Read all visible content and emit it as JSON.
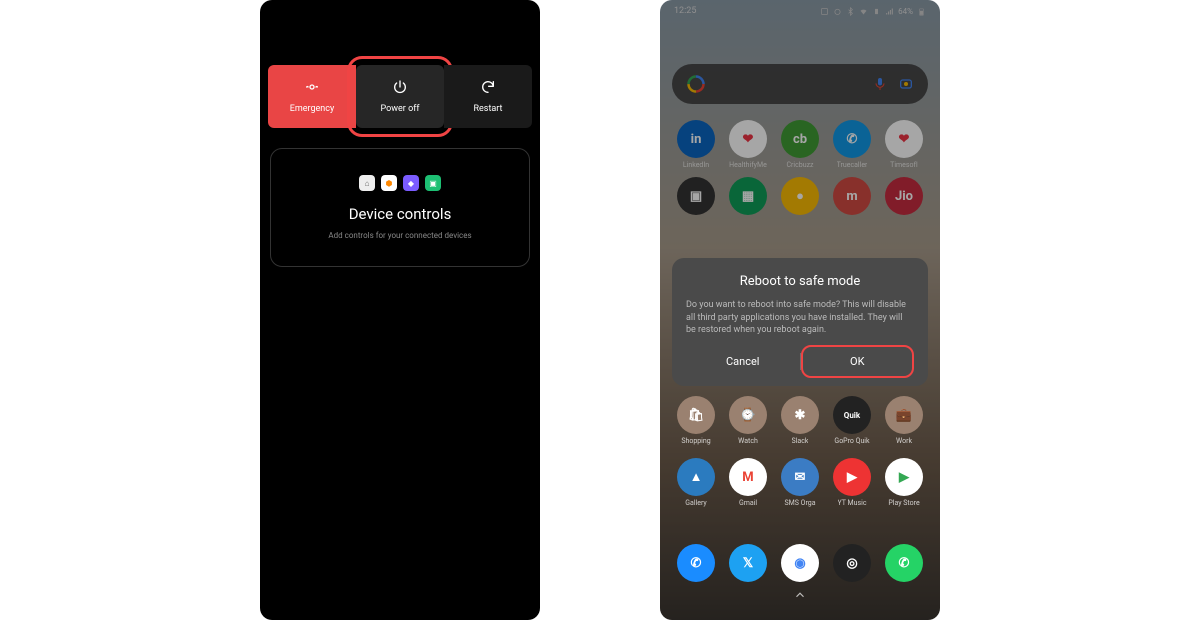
{
  "left": {
    "power_actions": {
      "emergency": "Emergency",
      "poweroff": "Power off",
      "restart": "Restart"
    },
    "device_controls": {
      "title": "Device controls",
      "subtitle": "Add controls for your connected devices"
    }
  },
  "right": {
    "status": {
      "time": "12:25",
      "battery": "64%"
    },
    "apps_row1": [
      {
        "label": "LinkedIn",
        "color": "#0a66c2",
        "text": "in"
      },
      {
        "label": "HealthifyMe",
        "color": "#ffffff",
        "text": "❤",
        "fg": "#e34"
      },
      {
        "label": "Cricbuzz",
        "color": "#3f9c35",
        "text": "cb"
      },
      {
        "label": "Truecaller",
        "color": "#1099e6",
        "text": "✆"
      },
      {
        "label": "TimesofI",
        "color": "#ffffff",
        "text": "❤",
        "fg": "#e34"
      }
    ],
    "apps_row2": [
      {
        "label": "",
        "color": "#333",
        "text": "▣"
      },
      {
        "label": "",
        "color": "#0f9d58",
        "text": "▦"
      },
      {
        "label": "",
        "color": "#fbbc04",
        "text": "●"
      },
      {
        "label": "",
        "color": "#d24a43",
        "text": "m"
      },
      {
        "label": "",
        "color": "#c72b3f",
        "text": "Jio"
      }
    ],
    "apps_row3": [
      {
        "label": "Shopping",
        "color": "#9a8170",
        "text": "🛍"
      },
      {
        "label": "Watch",
        "color": "#9a8170",
        "text": "⌚"
      },
      {
        "label": "Slack",
        "color": "#9a8170",
        "text": "✱"
      },
      {
        "label": "GoPro Quik",
        "color": "#222",
        "text": "Quik",
        "fsize": "8px"
      },
      {
        "label": "Work",
        "color": "#9a8170",
        "text": "💼"
      }
    ],
    "apps_row4": [
      {
        "label": "Gallery",
        "color": "#2b7bbf",
        "text": "▲"
      },
      {
        "label": "Gmail",
        "color": "#fff",
        "text": "M",
        "fg": "#ea4335"
      },
      {
        "label": "SMS Orga",
        "color": "#3b7cc4",
        "text": "✉"
      },
      {
        "label": "YT Music",
        "color": "#e33",
        "text": "▶"
      },
      {
        "label": "Play Store",
        "color": "#fff",
        "text": "▶",
        "fg": "#34a853"
      }
    ],
    "dock": [
      {
        "name": "phone",
        "color": "#1a8cff",
        "text": "✆"
      },
      {
        "name": "twitter",
        "color": "#1da1f2",
        "text": "𝕏"
      },
      {
        "name": "chrome",
        "color": "#fff",
        "text": "◉",
        "fg": "#4285f4"
      },
      {
        "name": "camera",
        "color": "#222",
        "text": "◎"
      },
      {
        "name": "whatsapp",
        "color": "#25d366",
        "text": "✆"
      }
    ],
    "dialog": {
      "title": "Reboot to safe mode",
      "body": "Do you want to reboot into safe mode? This will disable all third party applications you have installed. They will be restored when you reboot again.",
      "cancel": "Cancel",
      "ok": "OK"
    }
  }
}
